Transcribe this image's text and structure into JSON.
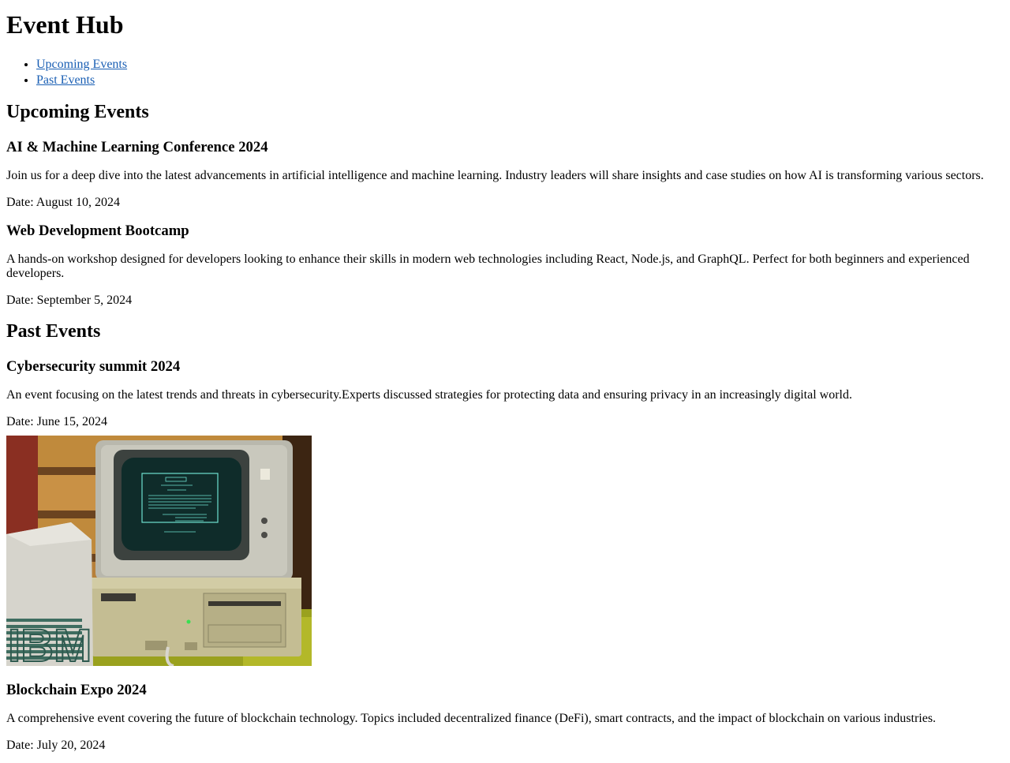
{
  "site": {
    "title": "Event Hub"
  },
  "nav": {
    "items": [
      {
        "label": "Upcoming Events"
      },
      {
        "label": "Past Events"
      }
    ]
  },
  "upcoming": {
    "heading": "Upcoming Events",
    "events": [
      {
        "title": "AI & Machine Learning Conference 2024",
        "description": "Join us for a deep dive into the latest advancements in artificial intelligence and machine learning. Industry leaders will share insights and case studies on how AI is transforming various sectors.",
        "date": "Date: August 10, 2024"
      },
      {
        "title": "Web Development Bootcamp",
        "description": "A hands-on workshop designed for developers looking to enhance their skills in modern web technologies including React, Node.js, and GraphQL. Perfect for both beginners and experienced developers.",
        "date": "Date: September 5, 2024"
      }
    ]
  },
  "past": {
    "heading": "Past Events",
    "events": [
      {
        "title": "Cybersecurity summit 2024",
        "description": "An event focusing on the latest trends and threats in cybersecurity.Experts discussed strategies for protecting data and ensuring privacy in an increasingly digital world.",
        "date": "Date: June 15, 2024"
      },
      {
        "title": "Blockchain Expo 2024",
        "description": "A comprehensive event covering the future of blockchain technology. Topics included decentralized finance (DeFi), smart contracts, and the impact of blockchain on various industries.",
        "date": "Date: July 20, 2024"
      }
    ],
    "photo_brand": "IBM"
  }
}
